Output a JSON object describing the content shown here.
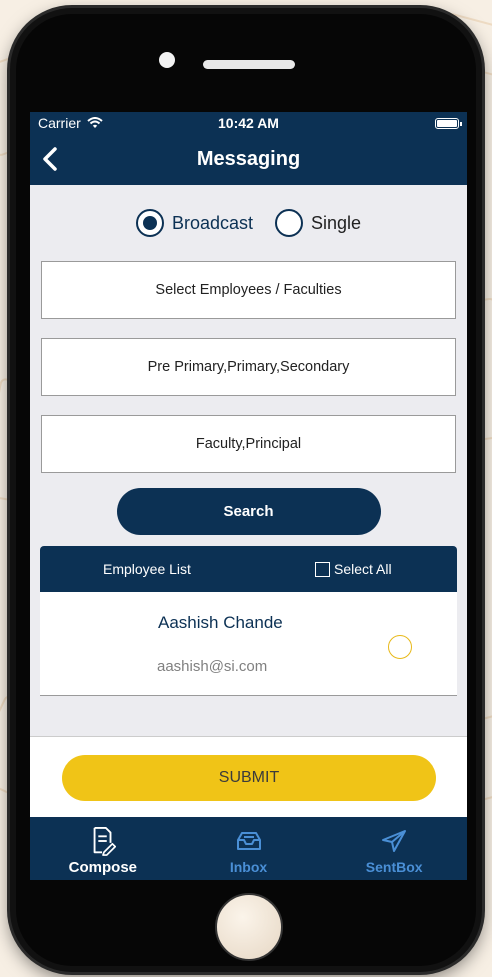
{
  "status_bar": {
    "carrier": "Carrier",
    "time": "10:42 AM"
  },
  "nav": {
    "title": "Messaging",
    "back_icon": "chevron-left-icon"
  },
  "message_type": {
    "options": [
      {
        "label": "Broadcast",
        "selected": true
      },
      {
        "label": "Single",
        "selected": false
      }
    ]
  },
  "filters": {
    "employees": "Select Employees / Faculties",
    "sections": "Pre Primary,Primary,Secondary",
    "roles": "Faculty,Principal"
  },
  "search_label": "Search",
  "employee_list": {
    "title": "Employee List",
    "select_all": "Select All",
    "items": [
      {
        "name": "Aashish Chande",
        "email": "aashish@si.com",
        "selected": false
      }
    ]
  },
  "submit_label": "SUBMIT",
  "tabs": [
    {
      "label": "Compose",
      "icon": "compose-icon",
      "active": true
    },
    {
      "label": "Inbox",
      "icon": "inbox-icon",
      "active": false
    },
    {
      "label": "SentBox",
      "icon": "send-icon",
      "active": false
    }
  ],
  "colors": {
    "primary": "#0c3154",
    "accent": "#f0c417",
    "tab_inactive": "#4a8fd6"
  }
}
